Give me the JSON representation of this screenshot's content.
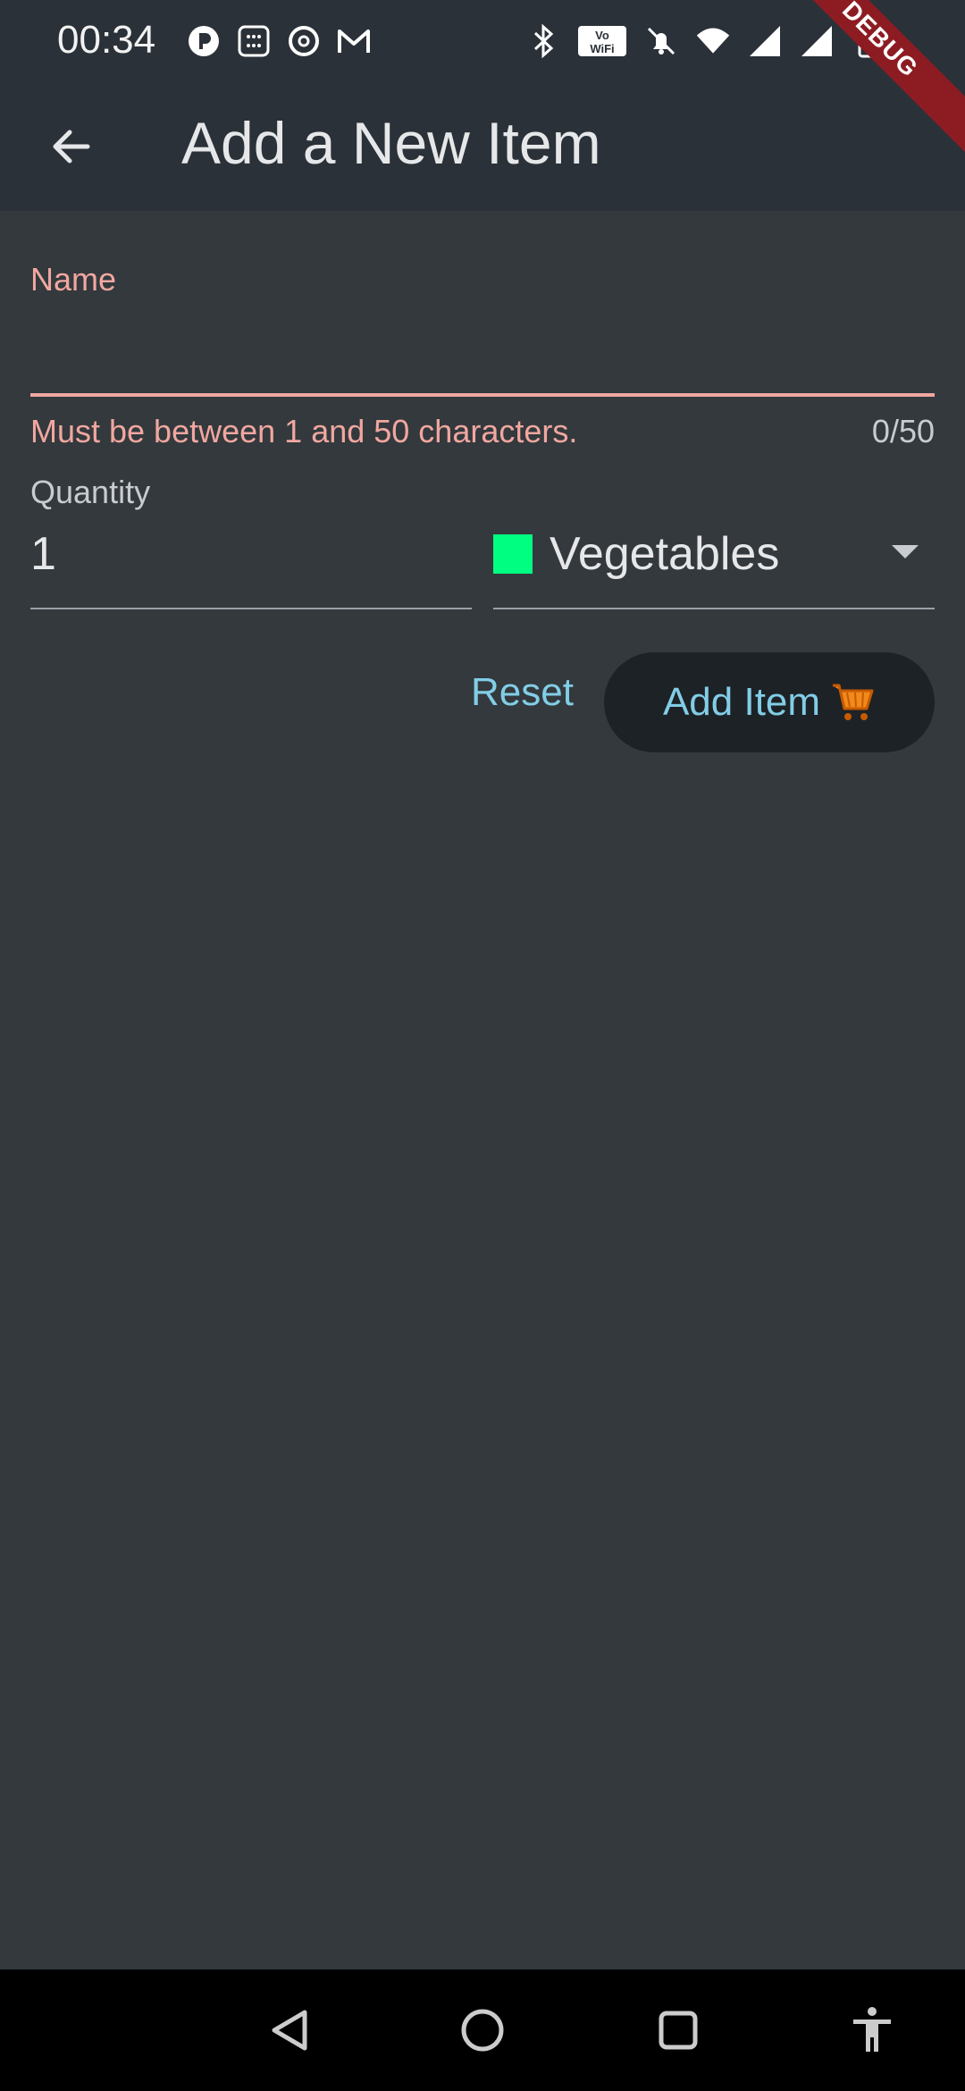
{
  "status_bar": {
    "time": "00:34",
    "left_icons": [
      "p-app-icon",
      "calculator-icon",
      "threads-icon",
      "gmail-icon"
    ],
    "right_icons": [
      "bluetooth-icon",
      "vowifi-icon",
      "mute-icon",
      "wifi-icon",
      "signal-icon",
      "signal-r-icon",
      "battery-icon"
    ]
  },
  "debug_banner": "DEBUG",
  "app_bar": {
    "title": "Add a New Item",
    "back_icon": "arrow-back-icon"
  },
  "form": {
    "name": {
      "label": "Name",
      "value": "",
      "error": "Must be between 1 and 50 characters.",
      "counter": "0/50",
      "accent": "#f1a7a0"
    },
    "quantity": {
      "label": "Quantity",
      "value": "1"
    },
    "category": {
      "value": "Vegetables",
      "swatch_color": "#00ff80"
    },
    "reset_label": "Reset",
    "add_label": "Add Item",
    "add_icon": "shopping-cart-icon"
  },
  "nav_bar": [
    "back-triangle-icon",
    "home-circle-icon",
    "recents-square-icon",
    "accessibility-icon"
  ]
}
